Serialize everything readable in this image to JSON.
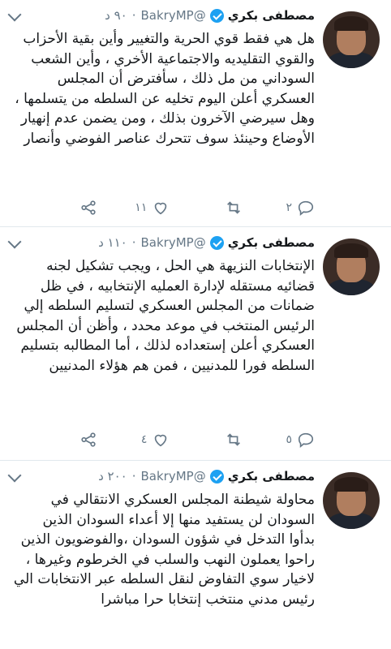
{
  "tweets": [
    {
      "name": "مصطفى بكري",
      "handle": "@BakryMP",
      "time": "٩٠ د",
      "text": "هل هي فقط قوي الحرية والتغيير وأين بقية الأحزاب والقوي التقليديه والاجتماعية الأخري ، وأين الشعب السوداني من مل ذلك ، سأفترض أن المجلس العسكري أعلن اليوم تخليه عن السلطه من يتسلمها ، وهل سيرضي الآخرون بذلك ، ومن يضمن عدم إنهيار الأوضاع وحينئذ سوف تتحرك عناصر الفوضي وأنصار",
      "replies": "٢",
      "retweets": "",
      "likes": "١١"
    },
    {
      "name": "مصطفى بكري",
      "handle": "@BakryMP",
      "time": "١١٠ د",
      "text": "الإنتخابات النزيهة هي الحل ، ويجب تشكيل لجنه قضائيه مستقله لإدارة العمليه الإنتخابيه ، في ظل ضمانات من المجلس العسكري لتسليم السلطه إلي الرئيس المنتخب في موعد محدد ، وأظن أن المجلس العسكري أعلن إستعداده لذلك ، أما المطالبه بتسليم السلطه فورا للمدنيين ، فمن هم هؤلاء المدنيين",
      "replies": "٥",
      "retweets": "",
      "likes": "٤"
    },
    {
      "name": "مصطفى بكري",
      "handle": "@BakryMP",
      "time": "٢٠٠ د",
      "text": "محاولة شيطنة المجلس العسكري الانتقالي في السودان لن يستفيد منها إلا أعداء السودان الذين بدأوا التدخل في شؤون السودان ،والفوضويون الذين راحوا يعملون النهب والسلب في الخرطوم وغيرها ، لاخيار سوي التفاوض لنقل السلطه عبر الانتخابات الي رئيس مدني منتخب إنتخابا حرا مباشرا"
    }
  ]
}
